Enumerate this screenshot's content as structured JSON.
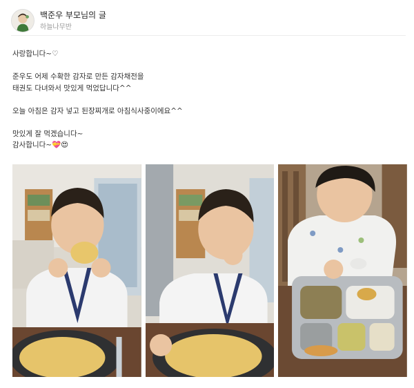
{
  "author": {
    "name": "백준우 부모님의 글",
    "subtitle": "하늘나무반"
  },
  "post": {
    "lines": [
      "사랑합니다~♡",
      "",
      "준우도 어제 수확한 감자로 만든 감자채전을",
      "태권도 다녀와서 맛있게 먹었답니다^^",
      "",
      "오늘 아침은 감자 넣고 된장찌개로 아침식사중이에요^^",
      "",
      "맛있게 잘 먹겠습니다~",
      "감사합니다~💝😍"
    ]
  },
  "photos": [
    {
      "subject": "boy-eating-potato-pancake-photo"
    },
    {
      "subject": "boy-tasting-potato-pancake-photo"
    },
    {
      "subject": "boy-breakfast-tray-photo"
    }
  ],
  "colors": {
    "divider": "#ececec",
    "subtitle": "#9a9a9a",
    "text": "#333333"
  }
}
